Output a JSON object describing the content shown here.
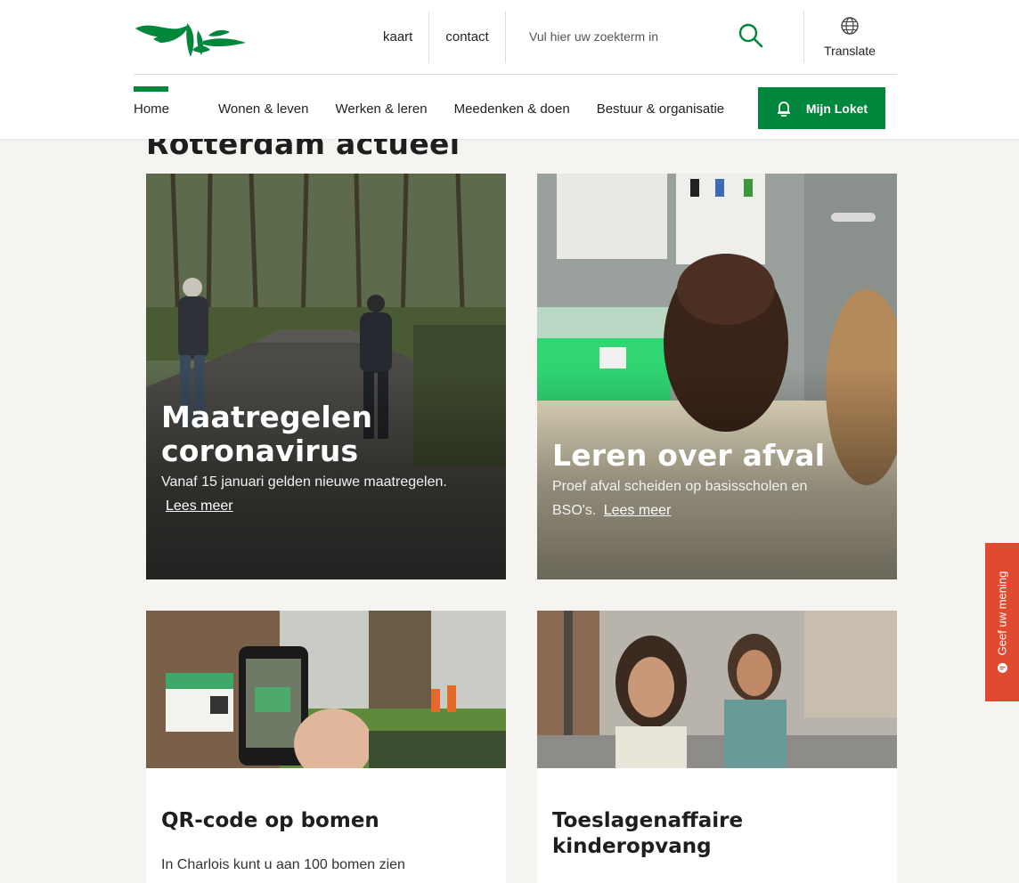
{
  "header": {
    "top_links": [
      {
        "label": "kaart"
      },
      {
        "label": "contact"
      }
    ],
    "search": {
      "placeholder": "Vul hier uw zoekterm in"
    },
    "translate_label": "Translate",
    "nav": [
      "Home",
      "Wonen & leven",
      "Werken & leren",
      "Meedenken & doen",
      "Bestuur & organisatie"
    ],
    "loket_label": "Mijn Loket"
  },
  "section_title": "Rotterdam actueel",
  "cards": [
    {
      "title_lines": [
        "Maatregelen",
        "coronavirus"
      ],
      "description": "Vanaf 15 januari gelden nieuwe maatregelen.",
      "link": "Lees meer"
    },
    {
      "title_lines": [
        "Leren over afval"
      ],
      "description_line1": "Proef afval scheiden op basisscholen en",
      "description_line2": "BSO's.",
      "link": "Lees meer"
    },
    {
      "title": "QR-code op bomen",
      "description": "In Charlois kunt u aan 100 bomen zien"
    },
    {
      "title_lines": [
        "Toeslagenaffaire",
        "kinderopvang"
      ]
    }
  ],
  "feedback_label": "Geef uw mening",
  "colors": {
    "brand_green": "#00873c",
    "feedback_red": "#e04a31"
  }
}
